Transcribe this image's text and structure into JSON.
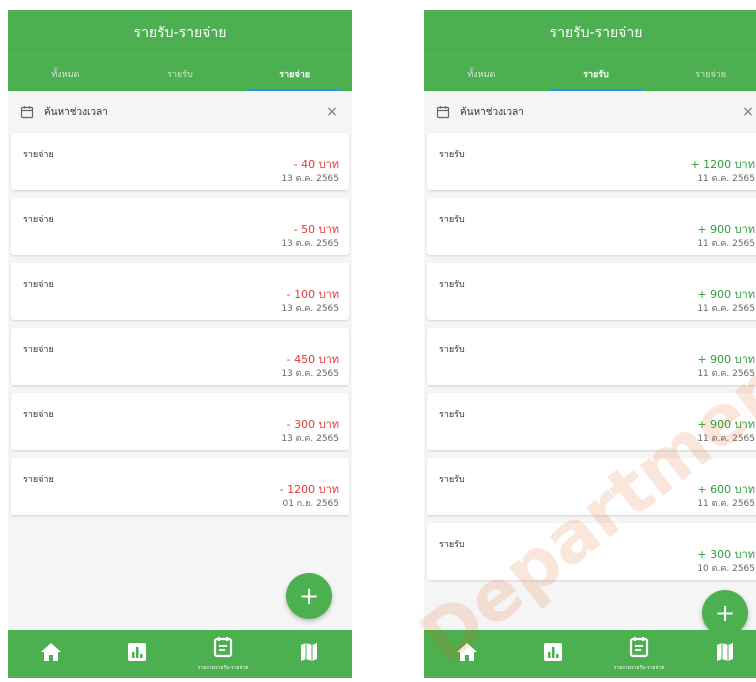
{
  "left": {
    "title": "รายรับ-รายจ่าย",
    "tabs": [
      {
        "label": "ทั้งหมด"
      },
      {
        "label": "รายรับ"
      },
      {
        "label": "รายจ่าย"
      }
    ],
    "search": {
      "label": "ค้นหาช่วงเวลา",
      "close": "×"
    },
    "items": [
      {
        "title": "รายจ่าย",
        "amount": "- 40 บาท",
        "date": "13 ต.ค. 2565"
      },
      {
        "title": "รายจ่าย",
        "amount": "- 50 บาท",
        "date": "13 ต.ค. 2565"
      },
      {
        "title": "รายจ่าย",
        "amount": "- 100 บาท",
        "date": "13 ต.ค. 2565"
      },
      {
        "title": "รายจ่าย",
        "amount": "- 450 บาท",
        "date": "13 ต.ค. 2565"
      },
      {
        "title": "รายจ่าย",
        "amount": "- 300 บาท",
        "date": "13 ต.ค. 2565"
      },
      {
        "title": "รายจ่าย",
        "amount": "- 1200 บาท",
        "date": "01 ก.ย. 2565"
      }
    ],
    "fab": "+",
    "nav_caption": "รายงานรายรับ-รายจ่าย"
  },
  "right": {
    "title": "รายรับ-รายจ่าย",
    "tabs": [
      {
        "label": "ทั้งหมด"
      },
      {
        "label": "รายรับ"
      },
      {
        "label": "รายจ่าย"
      }
    ],
    "search": {
      "label": "ค้นหาช่วงเวลา",
      "close": "×"
    },
    "items": [
      {
        "title": "รายรับ",
        "amount": "+ 1200 บาท",
        "date": "11 ต.ค. 2565"
      },
      {
        "title": "รายรับ",
        "amount": "+ 900 บาท",
        "date": "11 ต.ค. 2565"
      },
      {
        "title": "รายรับ",
        "amount": "+ 900 บาท",
        "date": "11 ต.ค. 2565"
      },
      {
        "title": "รายรับ",
        "amount": "+ 900 บาท",
        "date": "11 ต.ค. 2565"
      },
      {
        "title": "รายรับ",
        "amount": "+ 900 บาท",
        "date": "11 ต.ค. 2565"
      },
      {
        "title": "รายรับ",
        "amount": "+ 600 บาท",
        "date": "11 ต.ค. 2565"
      },
      {
        "title": "รายรับ",
        "amount": "+ 300 บาท",
        "date": "10 ต.ค. 2565"
      }
    ],
    "fab": "+",
    "nav_caption": "รายงานรายรับ-รายจ่าย"
  },
  "watermark": "Department",
  "icons": {
    "calendar": "calendar-icon",
    "close": "close-icon",
    "home": "home-icon",
    "chart": "bar-chart-icon",
    "report": "report-icon",
    "map": "map-icon"
  },
  "colors": {
    "primary": "#4caf50",
    "tab_indicator": "#2196f3",
    "expense": "#e53935",
    "income": "#2e9e3a",
    "background": "#f5f5f5"
  }
}
